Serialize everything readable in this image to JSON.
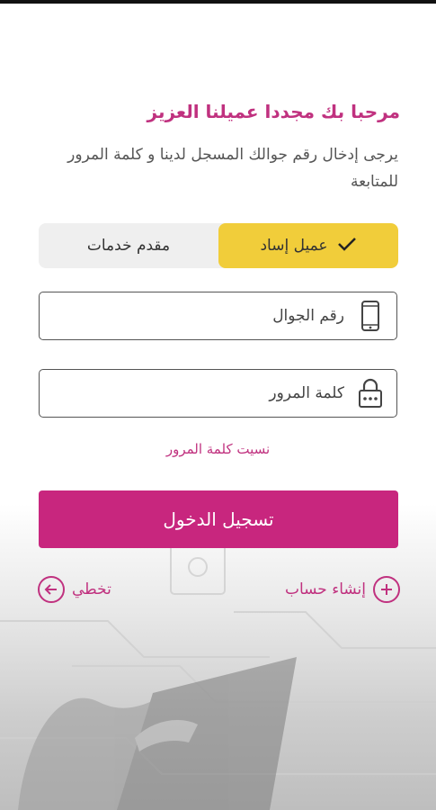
{
  "header": {
    "welcome": "مرحبا بك مجددا عميلنا العزيز",
    "instructions": "يرجى إدخال رقم جوالك المسجل لدينا و كلمة المرور للمتابعة"
  },
  "segment": {
    "customer_label": "عميل إساد",
    "provider_label": "مقدم خدمات"
  },
  "form": {
    "phone_placeholder": "رقم الجوال",
    "password_placeholder": "كلمة المرور",
    "forgot_password": "نسيت كلمة المرور",
    "login_label": "تسجيل الدخول"
  },
  "footer": {
    "create_account": "إنشاء حساب",
    "skip": "تخطي"
  },
  "colors": {
    "brand": "#c8267e",
    "accent_yellow": "#f1cd3a"
  }
}
